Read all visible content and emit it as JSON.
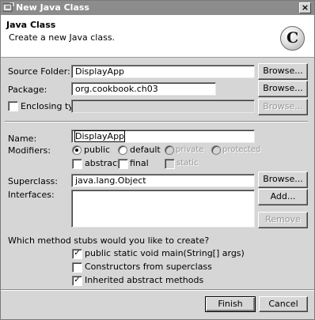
{
  "window": {
    "title": "New Java Class",
    "close_glyph": "×"
  },
  "banner": {
    "heading": "Java Class",
    "description": "Create a new Java class.",
    "icon_letter": "C"
  },
  "source_folder": {
    "label": "Source Folder:",
    "value": "DisplayApp",
    "browse": "Browse..."
  },
  "package": {
    "label": "Package:",
    "value": "org.cookbook.ch03",
    "browse": "Browse..."
  },
  "enclosing": {
    "label": "Enclosing type:",
    "value": "",
    "browse": "Browse...",
    "checked": false
  },
  "name": {
    "label": "Name:",
    "value": "DisplayApp"
  },
  "modifiers": {
    "label": "Modifiers:",
    "public": "public",
    "default": "default",
    "private": "private",
    "protected": "protected",
    "abstract": "abstract",
    "final": "final",
    "static": "static",
    "selected": "public"
  },
  "superclass": {
    "label": "Superclass:",
    "value": "java.lang.Object",
    "browse": "Browse..."
  },
  "interfaces": {
    "label": "Interfaces:",
    "add": "Add...",
    "remove": "Remove"
  },
  "stubs": {
    "question": "Which method stubs would you like to create?",
    "main": "public static void main(String[] args)",
    "constructors": "Constructors from superclass",
    "inherited": "Inherited abstract methods",
    "check_glyph": "✓"
  },
  "footer": {
    "finish": "Finish",
    "cancel": "Cancel"
  }
}
